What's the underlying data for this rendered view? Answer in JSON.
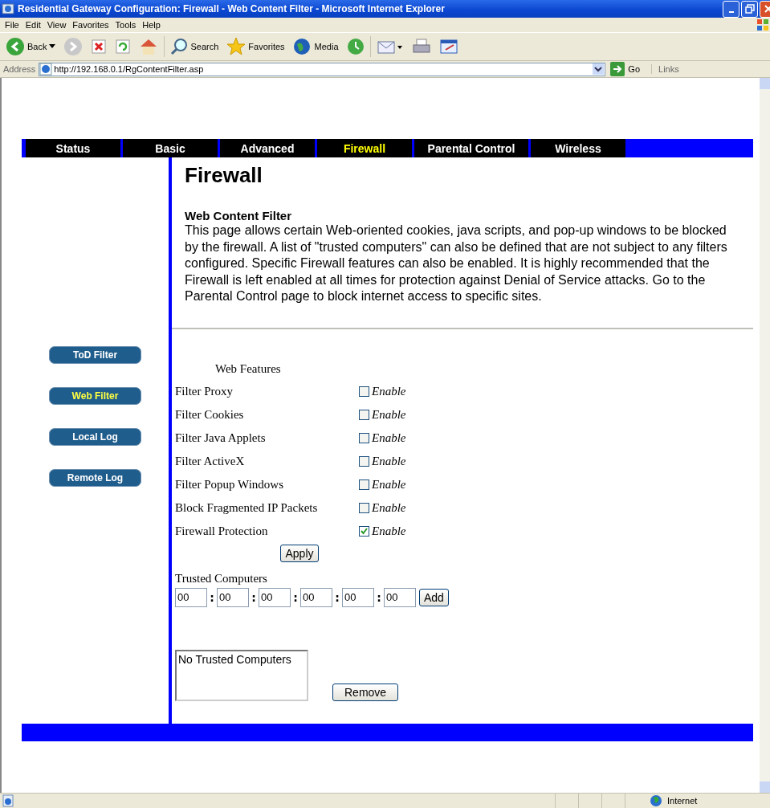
{
  "window": {
    "title": "Residential Gateway Configuration: Firewall - Web Content Filter - Microsoft Internet Explorer"
  },
  "menu": [
    "File",
    "Edit",
    "View",
    "Favorites",
    "Tools",
    "Help"
  ],
  "toolbar": {
    "back": "Back",
    "search": "Search",
    "favorites": "Favorites",
    "media": "Media"
  },
  "address": {
    "label": "Address",
    "url": "http://192.168.0.1/RgContentFilter.asp",
    "go": "Go",
    "links": "Links"
  },
  "nav_tabs": [
    {
      "label": "Status",
      "selected": false
    },
    {
      "label": "Basic",
      "selected": false
    },
    {
      "label": "Advanced",
      "selected": false
    },
    {
      "label": "Firewall",
      "selected": true
    },
    {
      "label": "Parental Control",
      "selected": false
    },
    {
      "label": "Wireless",
      "selected": false
    }
  ],
  "sidebar": [
    {
      "label": "ToD Filter",
      "selected": false
    },
    {
      "label": "Web Filter",
      "selected": true
    },
    {
      "label": "Local Log",
      "selected": false
    },
    {
      "label": "Remote Log",
      "selected": false
    }
  ],
  "heading": "Firewall",
  "subheading": "Web Content Filter",
  "description": "This page allows certain Web-oriented cookies, java scripts, and pop-up windows to be blocked by the firewall.  A list of \"trusted computers\" can also be defined that are not subject to any filters configured. Specific Firewall features can also be enabled.  It is highly recommended that the Firewall is left enabled at all times for protection against Denial of Service attacks. Go to the Parental Control page to block internet access to specific sites.",
  "web_features": {
    "title": "Web Features",
    "items": [
      {
        "label": "Filter Proxy",
        "checked": false,
        "option": "Enable"
      },
      {
        "label": "Filter Cookies",
        "checked": false,
        "option": "Enable"
      },
      {
        "label": "Filter Java Applets",
        "checked": false,
        "option": "Enable"
      },
      {
        "label": "Filter ActiveX",
        "checked": false,
        "option": "Enable"
      },
      {
        "label": "Filter Popup Windows",
        "checked": false,
        "option": "Enable"
      },
      {
        "label": "Block Fragmented IP Packets",
        "checked": false,
        "option": "Enable"
      },
      {
        "label": "Firewall Protection",
        "checked": true,
        "option": "Enable"
      }
    ]
  },
  "apply_button": "Apply",
  "trusted": {
    "label": "Trusted Computers",
    "separator": ":",
    "mac_fields": [
      "00",
      "00",
      "00",
      "00",
      "00",
      "00"
    ],
    "add_button": "Add",
    "list_items": [
      "No Trusted Computers"
    ],
    "remove_button": "Remove"
  },
  "status_bar": {
    "zone": "Internet"
  }
}
